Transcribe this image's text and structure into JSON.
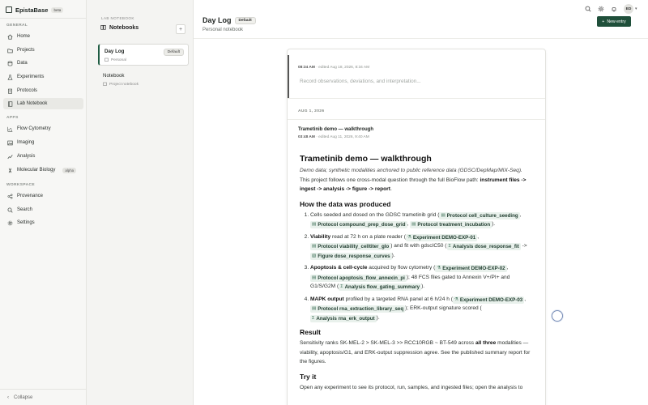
{
  "brand": {
    "name": "EpistaBase",
    "badge": "beta"
  },
  "sidebar": {
    "general_label": "GENERAL",
    "general": [
      {
        "label": "Home",
        "icon": "home-icon"
      },
      {
        "label": "Projects",
        "icon": "folder-icon"
      },
      {
        "label": "Data",
        "icon": "database-icon"
      },
      {
        "label": "Experiments",
        "icon": "flask-icon"
      },
      {
        "label": "Protocols",
        "icon": "clipboard-icon"
      },
      {
        "label": "Lab Notebook",
        "icon": "notebook-icon",
        "active": true
      }
    ],
    "apps_label": "APPS",
    "apps": [
      {
        "label": "Flow Cytometry",
        "icon": "flow-icon"
      },
      {
        "label": "Imaging",
        "icon": "image-icon"
      },
      {
        "label": "Analysis",
        "icon": "chart-icon"
      },
      {
        "label": "Molecular Biology",
        "icon": "dna-icon",
        "badge": "alpha"
      }
    ],
    "workspace_label": "WORKSPACE",
    "workspace": [
      {
        "label": "Provenance",
        "icon": "share-icon"
      },
      {
        "label": "Search",
        "icon": "search-icon"
      },
      {
        "label": "Settings",
        "icon": "gear-icon"
      }
    ],
    "collapse": "Collapse"
  },
  "notebooks": {
    "eyebrow": "LAB NOTEBOOK",
    "header": "Notebooks",
    "items": [
      {
        "title": "Day Log",
        "subtitle": "Personal",
        "badge": "Default"
      },
      {
        "title": "Notebook",
        "subtitle": "Project notebook"
      }
    ]
  },
  "topbar": {
    "avatar": "ED"
  },
  "page": {
    "title": "Day Log",
    "badge": "Default",
    "subtitle": "Personal notebook",
    "new_entry": "New entry"
  },
  "draft": {
    "time": "08:34 AM",
    "edited": "· edited Aug 18, 2026, 8:34 AM",
    "placeholder": "Record observations, deviations, and interpretation..."
  },
  "entry": {
    "date_label": "AUG 1, 2026",
    "title": "Trametinib demo — walkthrough",
    "time": "03:48 AM",
    "edited": "· edited Aug 11, 2026, 9:40 AM",
    "h1": "Trametinib demo — walkthrough",
    "intro": "Demo data; synthetic modalities anchored to public reference data (GDSC/DepMap/MIX-Seq).",
    "path_prefix": "This project follows one cross-modal question through the full BioFlow path: ",
    "path_bold": "instrument files -> ingest -> analysis -> figure -> report",
    "path_suffix": ".",
    "h2_data": "How the data was produced",
    "li1_text": "Cells seeded and dosed on the GDSC trametinib grid (",
    "li1_chip1": "Protocol cell_culture_seeding",
    "li1_chip2": "Protocol compound_prep_dose_grid",
    "li1_chip3": "Protocol treatment_incubation",
    "li1_end": ").",
    "li2_bold": "Viability",
    "li2_text": " read at 72 h on a plate reader (",
    "li2_chip1": "Experiment DEMO-EXP-01",
    "li2_chip2": "Protocol viability_celltiter_glo",
    "li2_mid": ") and fit with gdscIC50 (",
    "li2_chip3": "Analysis dose_response_fit",
    "li2_arrow": " -> ",
    "li2_chip4": "Figure dose_response_curves",
    "li2_end": ").",
    "li3_bold": "Apoptosis & cell-cycle",
    "li3_text": " acquired by flow cytometry (",
    "li3_chip1": "Experiment DEMO-EXP-02",
    "li3_chip2": "Protocol apoptosis_flow_annexin_pi",
    "li3_mid": "); 48 FCS files gated to Annexin V+/PI+ and G1/S/G2M (",
    "li3_chip3": "Analysis flow_gating_summary",
    "li3_end": ").",
    "li4_bold": "MAPK output",
    "li4_text": " profiled by a targeted RNA panel at 6 h/24 h (",
    "li4_chip1": "Experiment DEMO-EXP-03",
    "li4_chip2": "Protocol rna_extraction_library_seq",
    "li4_mid": "); ERK-output signature scored (",
    "li4_chip3": "Analysis rna_erk_output",
    "li4_end": ").",
    "h2_result": "Result",
    "result_pre": "Sensitivity ranks SK-MEL-2 > SK-MEL-3 >> RCC10RGB ~ BT-549 across ",
    "result_bold": "all three",
    "result_post": " modalities — viability, apoptosis/G1, and ERK-output suppression agree. See the published summary report for the figures.",
    "h2_try": "Try it",
    "try_text": "Open any experiment to see its protocol, run, samples, and ingested files; open the analysis to"
  }
}
